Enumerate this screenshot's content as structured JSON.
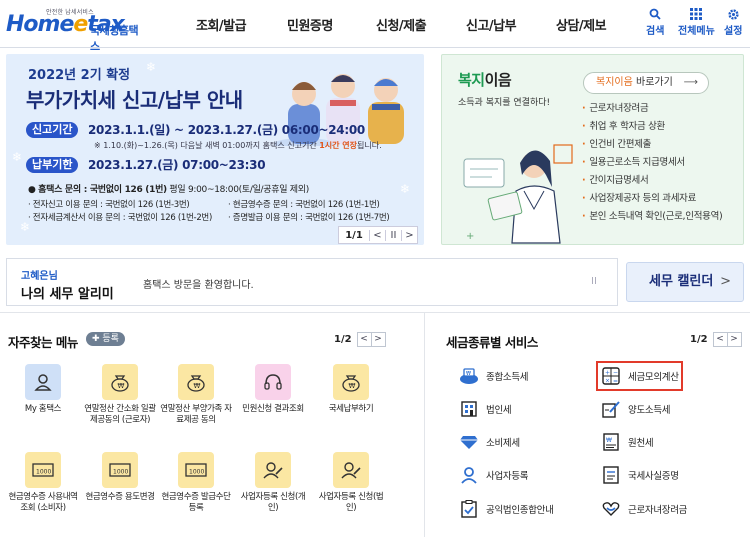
{
  "header": {
    "logo_small": "안전한 납세서비스",
    "logo_home": "Home",
    "logo_e": "e",
    "logo_tax": "tax",
    "logo_kor": "국세청홈택스",
    "nav": [
      "조회/발급",
      "민원증명",
      "신청/제출",
      "신고/납부",
      "상담/제보"
    ],
    "util": [
      {
        "label": "검색",
        "icon": "search-icon"
      },
      {
        "label": "전체메뉴",
        "icon": "grid-icon"
      },
      {
        "label": "설정",
        "icon": "gear-icon"
      }
    ]
  },
  "banner": {
    "title1": "2022년 2기 확정",
    "title2": "부가가치세 신고/납부 안내",
    "period_label": "신고기간",
    "period_text": "2023.1.1.(일) ~ 2023.1.27.(금) 06:00~24:00",
    "note_pre": "※ 1.10.(화)~1.26.(목) 다음날 새벽 01:00까지 홈택스 신고기간 ",
    "note_hl": "1시간 연장",
    "note_post": "됩니다.",
    "deadline_label": "납부기한",
    "deadline_text": "2023.1.27.(금) 07:00~23:30",
    "info1_bold": "홈택스 문의 : 국번없이 126 (1번)",
    "info1_rest": " 평일 9:00~18:00(토/일/공휴일 제외)",
    "info2a": "· 전자신고 이용 문의 : 국번없이 126 (1번-3번)",
    "info2b": "· 현금영수증 문의 : 국번없이 126 (1번-1번)",
    "info3a": "· 전자세금계산서 이용 문의 : 국번없이 126 (1번-2번)",
    "info3b": "· 증명발급 이용 문의 : 국번없이 126 (1번-7번)",
    "pager": {
      "text": "1/1",
      "prev": "<",
      "pause": "II",
      "next": ">"
    }
  },
  "welfare": {
    "title_green": "복지",
    "title_rest": "이음",
    "subtitle": "소득과 복지를 연결하다!",
    "go_orange": "복지이음",
    "go_rest": " 바로가기",
    "go_arrow": "⟶",
    "items": [
      "근로자녀장려금",
      "취업 후 학자금 상환",
      "인건비 간편제출",
      "일용근로소득 지급명세서",
      "간이지급명세서",
      "사업장제공자 등의 과세자료",
      "본인 소득내역 확인(근로,인적용역)"
    ]
  },
  "notice": {
    "user_name": "고혜은님",
    "title": "나의 세무 알리미",
    "message": "홈택스 방문을 환영합니다.",
    "pause": "II",
    "calendar_label": "세무 캘린더",
    "calendar_arrow": ">"
  },
  "frequent": {
    "title": "자주찾는 메뉴",
    "register": "✚ 등록",
    "pager": {
      "text": "1/2",
      "prev": "<",
      "next": ">"
    },
    "items": [
      {
        "label": "My 홈택스",
        "icon": "user-icon",
        "color": "blue"
      },
      {
        "label": "연말정산 간소화 일괄제공동의 (근로자)",
        "icon": "money-bag-icon",
        "color": "yellow"
      },
      {
        "label": "연말정산 부양가족 자료제공 동의",
        "icon": "money-bag-icon",
        "color": "yellow"
      },
      {
        "label": "민원신청 결과조회",
        "icon": "headset-icon",
        "color": "pink"
      },
      {
        "label": "국세납부하기",
        "icon": "money-bag-icon",
        "color": "yellow"
      },
      {
        "label": "현금영수증 사용내역조회 (소비자)",
        "icon": "bill-icon",
        "color": "yellow"
      },
      {
        "label": "현금영수증 용도변경",
        "icon": "bill-icon",
        "color": "yellow"
      },
      {
        "label": "현금영수증 발급수단 등록",
        "icon": "bill-icon",
        "color": "yellow"
      },
      {
        "label": "사업자등록 신청(개인)",
        "icon": "user-edit-icon",
        "color": "yellow"
      },
      {
        "label": "사업자등록 신청(법인)",
        "icon": "user-edit-icon",
        "color": "yellow"
      }
    ]
  },
  "services": {
    "title": "세금종류별 서비스",
    "pager": {
      "text": "1/2",
      "prev": "<",
      "next": ">"
    },
    "items": [
      {
        "label": "종합소득세",
        "icon": "money-pile-icon"
      },
      {
        "label": "세금모의계산",
        "icon": "calculator-icon"
      },
      {
        "label": "법인세",
        "icon": "building-icon"
      },
      {
        "label": "양도소득세",
        "icon": "document-pen-icon"
      },
      {
        "label": "소비제세",
        "icon": "diamond-icon"
      },
      {
        "label": "원천세",
        "icon": "receipt-icon"
      },
      {
        "label": "사업자등록",
        "icon": "person-icon"
      },
      {
        "label": "국세사실증명",
        "icon": "certificate-icon"
      },
      {
        "label": "공익법인종합안내",
        "icon": "checklist-icon"
      },
      {
        "label": "근로자녀장려금",
        "icon": "heart-hands-icon"
      }
    ]
  },
  "colors": {
    "brand": "#1e5bc6",
    "accent": "#e36b1b",
    "highlight": "#e23a2a"
  }
}
